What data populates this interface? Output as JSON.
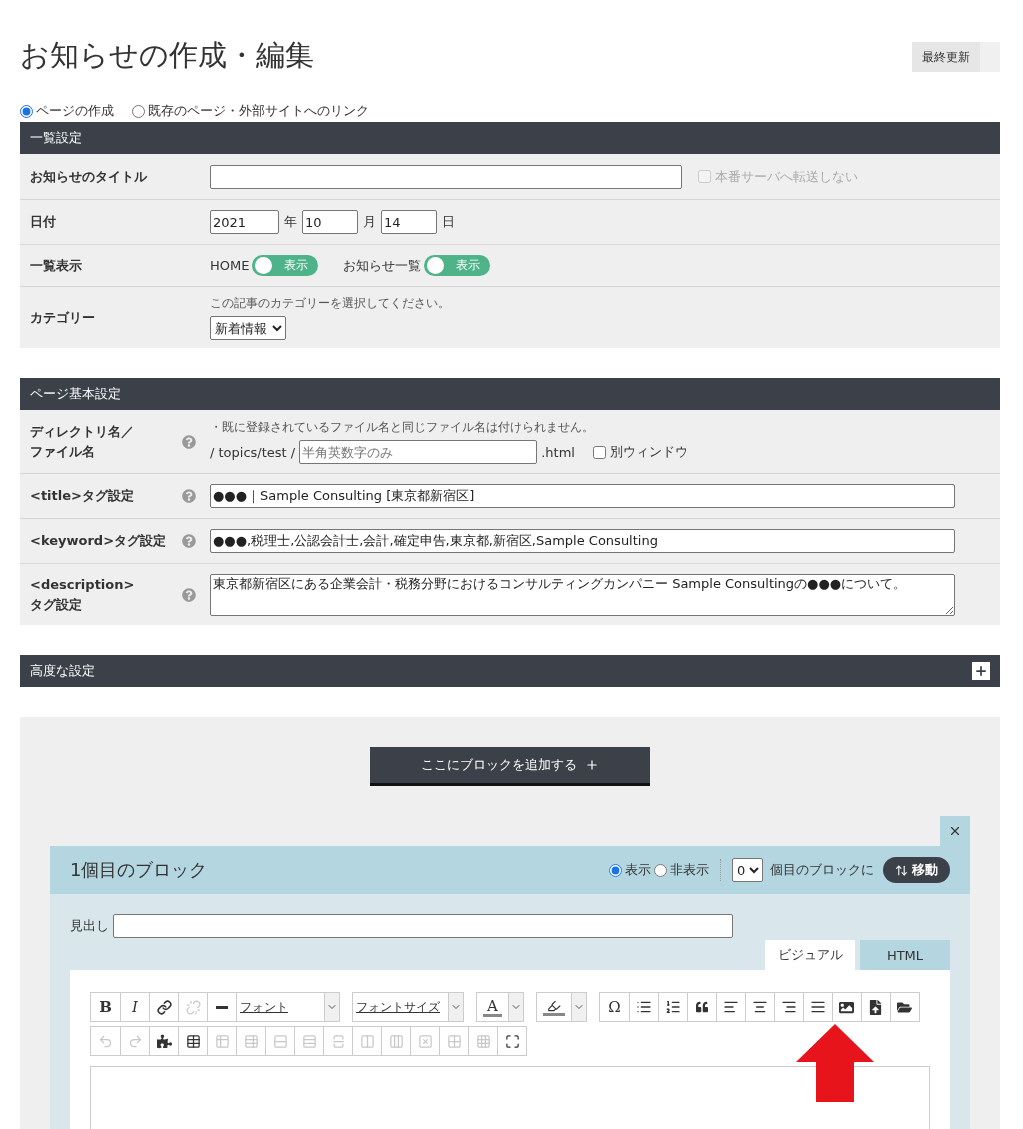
{
  "page": {
    "title": "お知らせの作成・編集",
    "last_updated_button": "最終更新"
  },
  "page_type": [
    {
      "label": "ページの作成",
      "selected": true
    },
    {
      "label": "既存のページ・外部サイトへのリンク",
      "selected": false
    }
  ],
  "list_settings": {
    "header": "一覧設定",
    "title_row": {
      "label": "お知らせのタイトル",
      "checkbox": {
        "label": "本番サーバへ転送しない",
        "checked": false,
        "disabled": true
      }
    },
    "date_row": {
      "label": "日付",
      "year": "2021",
      "year_unit": "年",
      "month": "10",
      "month_unit": "月",
      "day": "14",
      "day_unit": "日"
    },
    "display_row": {
      "label": "一覧表示",
      "toggles": [
        {
          "label": "HOME",
          "text": "表示",
          "on": true
        },
        {
          "label": "お知らせ一覧",
          "text": "表示",
          "on": true
        }
      ]
    },
    "category_row": {
      "label": "カテゴリー",
      "hint": "この記事のカテゴリーを選択してください。",
      "value": "新着情報"
    }
  },
  "basic_settings": {
    "header": "ページ基本設定",
    "rows": [
      {
        "kind": "file",
        "label": "ディレクトリ名／ファイル名",
        "hint": "・既に登録されているファイル名と同じファイル名は付けられません。",
        "prefix": "/ topics/test /",
        "placeholder": "半角英数字のみ",
        "suffix": ".html",
        "checkbox": {
          "label": "別ウィンドウ",
          "checked": false,
          "disabled": false
        }
      },
      {
        "kind": "input",
        "label": "<title>タグ設定",
        "value": "●●●｜Sample Consulting [東京都新宿区]"
      },
      {
        "kind": "input",
        "label": "<keyword>タグ設定",
        "value": "●●●,税理士,公認会計士,会計,確定申告,東京都,新宿区,Sample Consulting"
      },
      {
        "kind": "textarea",
        "label": "<description>\nタグ設定",
        "value": "東京都新宿区にある企業会計・税務分野におけるコンサルティングカンパニー Sample Consultingの●●●について。"
      }
    ]
  },
  "advanced_settings": {
    "header": "高度な設定",
    "expanded": false
  },
  "add_block_button": "ここにブロックを追加する",
  "block": {
    "title": "1個目のブロック",
    "visibility": [
      {
        "label": "表示",
        "selected": true
      },
      {
        "label": "非表示",
        "selected": false
      }
    ],
    "position_value": "0",
    "position_suffix": "個目のブロックに",
    "move_button": "移動",
    "heading_label": "見出し",
    "tabs": [
      {
        "label": "ビジュアル",
        "selected": true
      },
      {
        "label": "HTML",
        "selected": false
      }
    ],
    "toolbar": [
      [
        [
          {
            "kind": "text",
            "label": "B",
            "disabled": false
          },
          {
            "kind": "text",
            "label": "I",
            "disabled": false
          },
          {
            "kind": "icon",
            "disabled": false
          },
          {
            "kind": "icon",
            "disabled": true
          },
          {
            "kind": "icon",
            "disabled": false
          },
          {
            "kind": "select",
            "label": "フォント"
          }
        ],
        [
          {
            "kind": "select",
            "label": "フォントサイズ"
          }
        ],
        [
          {
            "kind": "split",
            "label": "A"
          }
        ],
        [
          {
            "kind": "split_icon"
          }
        ],
        [
          {
            "kind": "text",
            "label": "Ω",
            "disabled": false
          },
          {
            "kind": "icon",
            "disabled": false
          },
          {
            "kind": "icon",
            "disabled": false
          },
          {
            "kind": "icon",
            "disabled": false
          },
          {
            "kind": "icon",
            "disabled": false
          },
          {
            "kind": "icon",
            "disabled": false
          },
          {
            "kind": "icon",
            "disabled": false
          },
          {
            "kind": "icon",
            "disabled": false
          },
          {
            "kind": "icon",
            "disabled": false
          },
          {
            "kind": "icon",
            "disabled": false
          },
          {
            "kind": "icon",
            "disabled": false
          }
        ]
      ],
      [
        [
          {
            "kind": "icon",
            "disabled": true
          },
          {
            "kind": "icon",
            "disabled": true
          },
          {
            "kind": "icon",
            "disabled": false
          },
          {
            "kind": "icon",
            "disabled": false
          },
          {
            "kind": "icon",
            "disabled": true
          },
          {
            "kind": "icon",
            "disabled": true
          },
          {
            "kind": "icon",
            "disabled": true
          },
          {
            "kind": "icon",
            "disabled": true
          },
          {
            "kind": "icon",
            "disabled": true
          },
          {
            "kind": "icon",
            "disabled": true
          },
          {
            "kind": "icon",
            "disabled": true
          },
          {
            "kind": "icon",
            "disabled": true
          },
          {
            "kind": "icon",
            "disabled": true
          },
          {
            "kind": "icon",
            "disabled": true
          },
          {
            "kind": "icon",
            "disabled": false
          }
        ]
      ]
    ]
  }
}
